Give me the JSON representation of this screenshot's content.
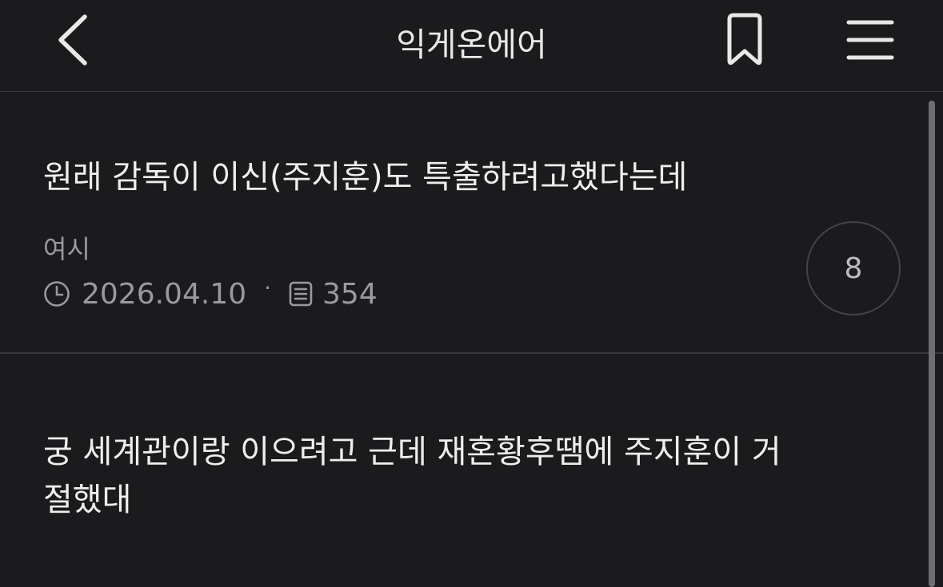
{
  "header": {
    "title": "익게온에어",
    "back_icon": "chevron-left-icon",
    "bookmark_icon": "bookmark-icon",
    "menu_icon": "hamburger-menu-icon"
  },
  "post": {
    "title": "원래 감독이 이신(주지훈)도 특출하려고했다는데",
    "author": "여시",
    "date": "2026.04.10",
    "separator": "·",
    "views": "354",
    "comment_count": "8",
    "body_lines": [
      "궁 세계관이랑 이으려고 근데 재혼황후땜에 주지훈이 거",
      "절했대"
    ]
  },
  "colors": {
    "background": "#1b1b1d",
    "text": "#eeeeee",
    "muted": "#9a9a9e",
    "divider": "#38383a"
  }
}
